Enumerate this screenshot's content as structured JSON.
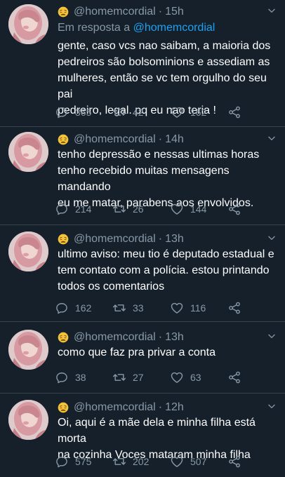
{
  "colors": {
    "background": "#15202b",
    "secondary_text": "#8899a6",
    "mention": "#1da1f2",
    "divider": "#38444d"
  },
  "icons": {
    "emoji": "weary-face-emoji-icon",
    "reply": "reply-icon",
    "retweet": "retweet-icon",
    "like": "heart-icon",
    "share": "share-icon",
    "menu": "chevron-down-icon"
  },
  "tweets": [
    {
      "handle": "@homemcordial",
      "separator": "·",
      "time": "15h",
      "reply_prefix": "Em resposta a",
      "reply_mention": "@homemcordial",
      "text": "gente, caso vcs nao saibam, a maioria dos\npedreiros são bolsominions e assediam as\nmulheres, então se vc tem orgulho do seu pai\npedreiro, legal. pq eu nao teria !",
      "replies": "365",
      "retweets": "42",
      "likes": "162"
    },
    {
      "handle": "@homemcordial",
      "separator": "·",
      "time": "14h",
      "text": "tenho depressão e nessas ultimas horas\ntenho recebido muitas mensagens mandando\neu me matar, parabens aos envolvidos.",
      "replies": "214",
      "retweets": "26",
      "likes": "144"
    },
    {
      "handle": "@homemcordial",
      "separator": "·",
      "time": "13h",
      "text": "ultimo aviso: meu tio é deputado estadual e\ntem contato com a polícia. estou printando\ntodos os comentarios",
      "replies": "162",
      "retweets": "33",
      "likes": "116"
    },
    {
      "handle": "@homemcordial",
      "separator": "·",
      "time": "13h",
      "text": "como que faz pra privar a conta",
      "replies": "38",
      "retweets": "27",
      "likes": "63"
    },
    {
      "handle": "@homemcordial",
      "separator": "·",
      "time": "12h",
      "text": "Oi, aqui é a mãe dela e minha filha está morta\nna cozinha Voces mataram minha filha",
      "replies": "575",
      "retweets": "202",
      "likes": "507"
    }
  ]
}
